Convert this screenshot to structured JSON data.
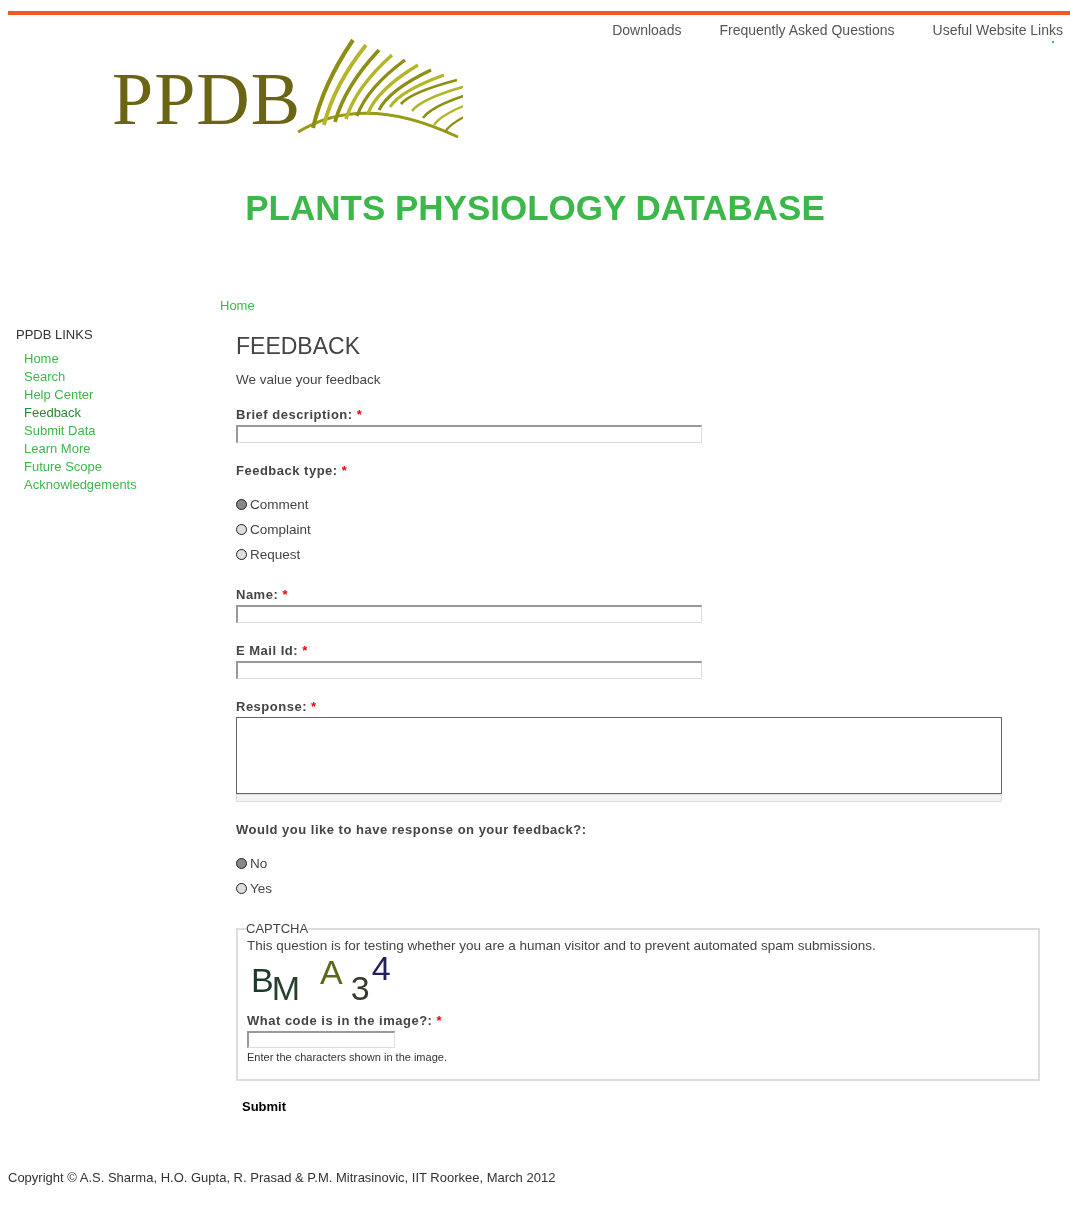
{
  "top_links": [
    "Downloads",
    "Frequently Asked Questions",
    "Useful Website Links"
  ],
  "logo": {
    "text": "PPDB"
  },
  "site_title": "PLANTS PHYSIOLOGY DATABASE",
  "breadcrumb": [
    "Home"
  ],
  "sidebar": {
    "title": "PPDB LINKS",
    "items": [
      {
        "label": "Home",
        "selected": false
      },
      {
        "label": "Search",
        "selected": false
      },
      {
        "label": "Help Center",
        "selected": false
      },
      {
        "label": "Feedback",
        "selected": true
      },
      {
        "label": "Submit Data",
        "selected": false
      },
      {
        "label": "Learn More",
        "selected": false
      },
      {
        "label": "Future Scope",
        "selected": false
      },
      {
        "label": "Acknowledgements",
        "selected": false
      }
    ]
  },
  "page_title": "FEEDBACK",
  "intro": "We value your feedback",
  "form": [
    {
      "kind": "text",
      "label": "Brief description:",
      "required_mark": "*"
    },
    {
      "kind": "radio",
      "label": "Feedback type:",
      "required_mark": "*",
      "options": [
        {
          "label": "Comment",
          "selected": true
        },
        {
          "label": "Complaint",
          "selected": false
        },
        {
          "label": "Request",
          "selected": false
        }
      ]
    },
    {
      "kind": "text",
      "label": "Name:",
      "required_mark": "*"
    },
    {
      "kind": "text",
      "label": "E Mail Id:",
      "required_mark": "*"
    },
    {
      "kind": "textarea",
      "label": "Response:",
      "required_mark": "*"
    },
    {
      "kind": "radio",
      "label": "Would you like to have response on your feedback?:",
      "options": [
        {
          "label": "No",
          "selected": true
        },
        {
          "label": "Yes",
          "selected": false
        }
      ]
    }
  ],
  "captcha": {
    "legend": "CAPTCHA",
    "description": "This question is for testing whether you are a human visitor and to prevent automated spam submissions.",
    "code_chars": [
      {
        "char": "B",
        "color": "#1e3a2a"
      },
      {
        "char": "M",
        "color": "#24402c"
      },
      {
        "char": "A",
        "color": "#5a6a1a"
      },
      {
        "char": "3",
        "color": "#3a3a2a"
      },
      {
        "char": "4",
        "color": "#24205a"
      }
    ],
    "field_label": "What code is in the image?:",
    "required_mark": "*",
    "hint": "Enter the characters shown in the image."
  },
  "submit": "Submit",
  "footer": "Copyright © A.S. Sharma, H.O. Gupta, R. Prasad & P.M. Mitrasinovic, IIT Roorkee, March 2012"
}
